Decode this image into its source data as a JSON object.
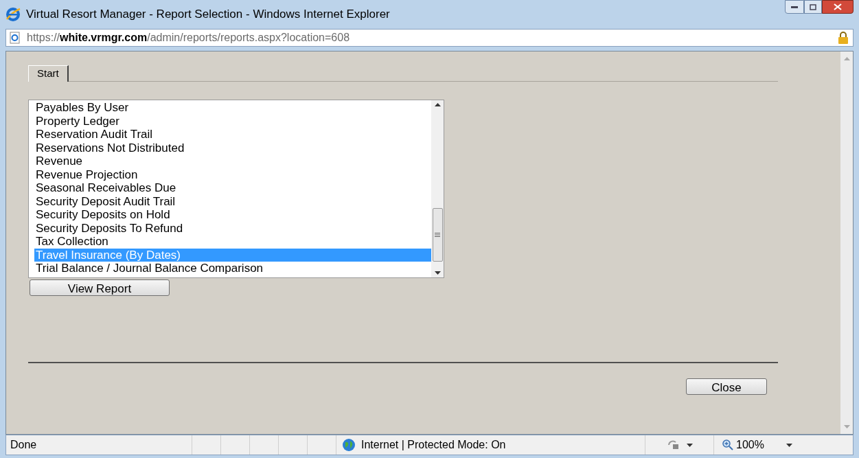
{
  "window": {
    "title": "Virtual Resort Manager - Report Selection - Windows Internet Explorer"
  },
  "address_bar": {
    "url": "https://**white.vrmgr.com**/admin/reports/reports.aspx?location=608"
  },
  "tabs": [
    {
      "label": "Start",
      "selected": true
    }
  ],
  "report_list": {
    "items": [
      {
        "label": "Payables By User",
        "selected": false
      },
      {
        "label": "Property Ledger",
        "selected": false
      },
      {
        "label": "Reservation Audit Trail",
        "selected": false
      },
      {
        "label": "Reservations Not Distributed",
        "selected": false
      },
      {
        "label": "Revenue",
        "selected": false
      },
      {
        "label": "Revenue Projection",
        "selected": false
      },
      {
        "label": "Seasonal Receivables Due",
        "selected": false
      },
      {
        "label": "Security Deposit Audit Trail",
        "selected": false
      },
      {
        "label": "Security Deposits on Hold",
        "selected": false
      },
      {
        "label": "Security Deposits To Refund",
        "selected": false
      },
      {
        "label": "Tax Collection",
        "selected": false
      },
      {
        "label": "Travel Insurance (By Dates)",
        "selected": true
      },
      {
        "label": "Trial Balance / Journal Balance Comparison",
        "selected": false
      }
    ]
  },
  "buttons": {
    "view_report": "View Report",
    "close": "Close"
  },
  "status_bar": {
    "status": "Done",
    "zone": "Internet | Protected Mode: On",
    "zoom": "100%"
  }
}
